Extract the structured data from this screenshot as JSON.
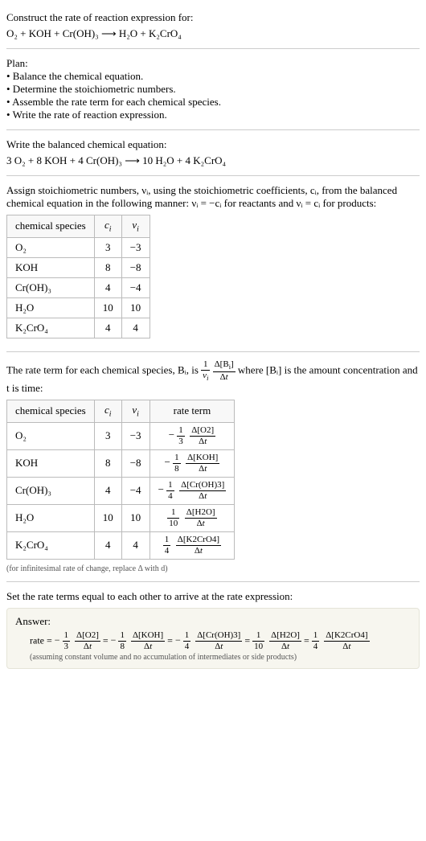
{
  "intro": {
    "title": "Construct the rate of reaction expression for:",
    "equation": "O₂ + KOH + Cr(OH)₃  ⟶  H₂O + K₂CrO₄"
  },
  "plan": {
    "title": "Plan:",
    "items": [
      "• Balance the chemical equation.",
      "• Determine the stoichiometric numbers.",
      "• Assemble the rate term for each chemical species.",
      "• Write the rate of reaction expression."
    ]
  },
  "balanced": {
    "title": "Write the balanced chemical equation:",
    "equation": "3 O₂ + 8 KOH + 4 Cr(OH)₃  ⟶  10 H₂O + 4 K₂CrO₄"
  },
  "assign": {
    "text_a": "Assign stoichiometric numbers, νᵢ, using the stoichiometric coefficients, cᵢ, from the balanced chemical equation in the following manner: νᵢ = −cᵢ for reactants and νᵢ = cᵢ for products:",
    "headers": [
      "chemical species",
      "cᵢ",
      "νᵢ"
    ],
    "rows": [
      {
        "sp": "O₂",
        "c": "3",
        "v": "−3"
      },
      {
        "sp": "KOH",
        "c": "8",
        "v": "−8"
      },
      {
        "sp": "Cr(OH)₃",
        "c": "4",
        "v": "−4"
      },
      {
        "sp": "H₂O",
        "c": "10",
        "v": "10"
      },
      {
        "sp": "K₂CrO₄",
        "c": "4",
        "v": "4"
      }
    ]
  },
  "rateterm": {
    "text_before": "The rate term for each chemical species, Bᵢ, is ",
    "text_after": " where [Bᵢ] is the amount concentration and t is time:",
    "headers": [
      "chemical species",
      "cᵢ",
      "νᵢ",
      "rate term"
    ],
    "rows": [
      {
        "sp": "O₂",
        "c": "3",
        "v": "−3",
        "coef": "−⅓",
        "coef_num": "1",
        "coef_den": "3",
        "neg": "−",
        "delta": "Δ[O2]"
      },
      {
        "sp": "KOH",
        "c": "8",
        "v": "−8",
        "coef_num": "1",
        "coef_den": "8",
        "neg": "−",
        "delta": "Δ[KOH]"
      },
      {
        "sp": "Cr(OH)₃",
        "c": "4",
        "v": "−4",
        "coef_num": "1",
        "coef_den": "4",
        "neg": "−",
        "delta": "Δ[Cr(OH)3]"
      },
      {
        "sp": "H₂O",
        "c": "10",
        "v": "10",
        "coef_num": "1",
        "coef_den": "10",
        "neg": "",
        "delta": "Δ[H2O]"
      },
      {
        "sp": "K₂CrO₄",
        "c": "4",
        "v": "4",
        "coef_num": "1",
        "coef_den": "4",
        "neg": "",
        "delta": "Δ[K2CrO4]"
      }
    ],
    "note": "(for infinitesimal rate of change, replace Δ with d)"
  },
  "final": {
    "title": "Set the rate terms equal to each other to arrive at the rate expression:",
    "answer_label": "Answer:",
    "rate_label": "rate = ",
    "terms": [
      {
        "neg": "−",
        "num": "1",
        "den": "3",
        "delta": "Δ[O2]"
      },
      {
        "neg": "−",
        "num": "1",
        "den": "8",
        "delta": "Δ[KOH]"
      },
      {
        "neg": "−",
        "num": "1",
        "den": "4",
        "delta": "Δ[Cr(OH)3]"
      },
      {
        "neg": "",
        "num": "1",
        "den": "10",
        "delta": "Δ[H2O]"
      },
      {
        "neg": "",
        "num": "1",
        "den": "4",
        "delta": "Δ[K2CrO4]"
      }
    ],
    "note": "(assuming constant volume and no accumulation of intermediates or side products)"
  },
  "chart_data": {
    "type": "table",
    "tables": [
      {
        "title": "Stoichiometric numbers",
        "columns": [
          "chemical species",
          "c_i",
          "ν_i"
        ],
        "rows": [
          [
            "O2",
            3,
            -3
          ],
          [
            "KOH",
            8,
            -8
          ],
          [
            "Cr(OH)3",
            4,
            -4
          ],
          [
            "H2O",
            10,
            10
          ],
          [
            "K2CrO4",
            4,
            4
          ]
        ]
      },
      {
        "title": "Rate terms",
        "columns": [
          "chemical species",
          "c_i",
          "ν_i",
          "rate term"
        ],
        "rows": [
          [
            "O2",
            3,
            -3,
            "-(1/3) Δ[O2]/Δt"
          ],
          [
            "KOH",
            8,
            -8,
            "-(1/8) Δ[KOH]/Δt"
          ],
          [
            "Cr(OH)3",
            4,
            -4,
            "-(1/4) Δ[Cr(OH)3]/Δt"
          ],
          [
            "H2O",
            10,
            10,
            "(1/10) Δ[H2O]/Δt"
          ],
          [
            "K2CrO4",
            4,
            4,
            "(1/4) Δ[K2CrO4]/Δt"
          ]
        ]
      }
    ],
    "rate_expression": "rate = -(1/3) Δ[O2]/Δt = -(1/8) Δ[KOH]/Δt = -(1/4) Δ[Cr(OH)3]/Δt = (1/10) Δ[H2O]/Δt = (1/4) Δ[K2CrO4]/Δt"
  }
}
